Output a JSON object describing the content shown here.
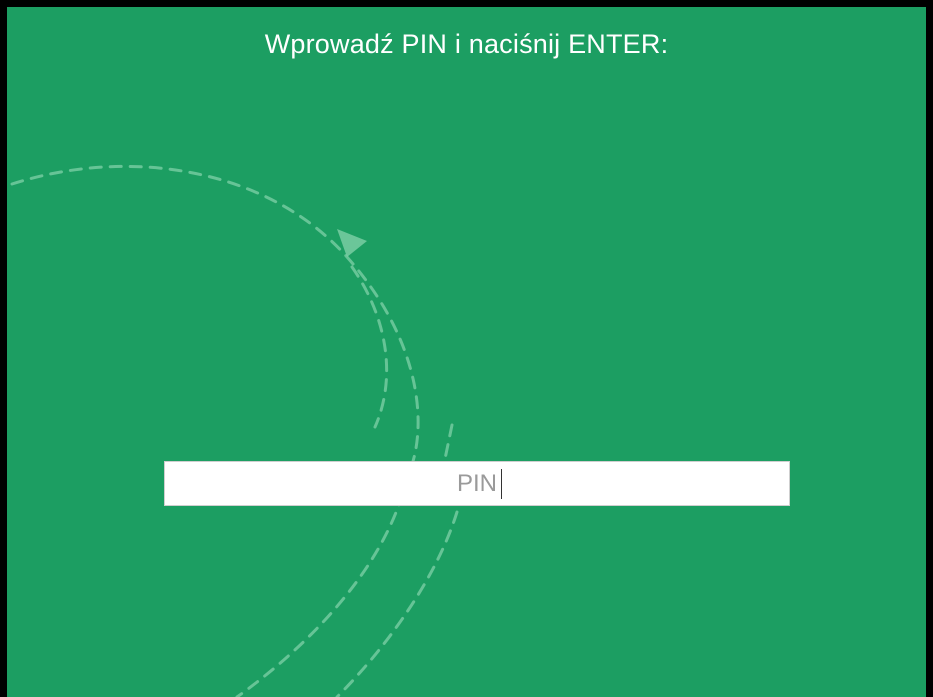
{
  "screen": {
    "background_color": "#1c9e62",
    "border_color": "#000000"
  },
  "prompt": {
    "text": "Wprowadź PIN i naciśnij ENTER:"
  },
  "pin_field": {
    "placeholder": "PIN",
    "value": ""
  },
  "decoration": {
    "icon": "dashed-circular-arrows-icon",
    "color": "#7fd4ac"
  }
}
